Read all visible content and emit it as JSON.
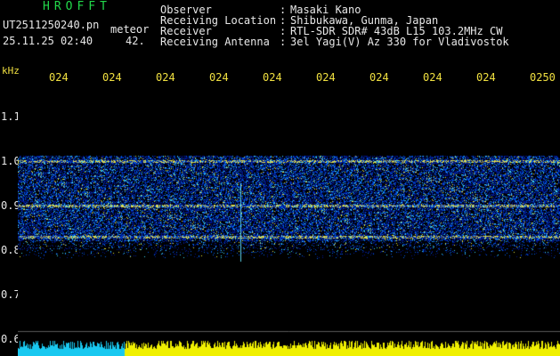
{
  "header": {
    "logo": "HROFFT",
    "filename": "UT2511250240.pn",
    "filetype": "meteor",
    "datetime": "25.11.25 02:40",
    "count": "42."
  },
  "info": [
    {
      "label": "Observer",
      "value": "Masaki Kano"
    },
    {
      "label": "Receiving Location",
      "value": "Shibukawa, Gunma, Japan"
    },
    {
      "label": "Receiver",
      "value": "RTL-SDR SDR# 43dB L15 103.2MHz CW"
    },
    {
      "label": "Receiving Antenna",
      "value": "3el Yagi(V) Az 330 for Vladivostok"
    }
  ],
  "axes": {
    "y_unit": "kHz",
    "y_ticks": [
      "1.1",
      "1.0",
      "0.9",
      "0.8",
      "0.7",
      "0.6"
    ],
    "x_ticks": [
      "024",
      "024",
      "024",
      "024",
      "024",
      "024",
      "024",
      "024",
      "024",
      "0250"
    ]
  },
  "colors": {
    "text_green": "#22d84a",
    "text_white": "#e8e8e8",
    "text_yellow": "#f0e040",
    "signal_cyan": "#19c8f0",
    "signal_yellow": "#f0f000"
  }
}
